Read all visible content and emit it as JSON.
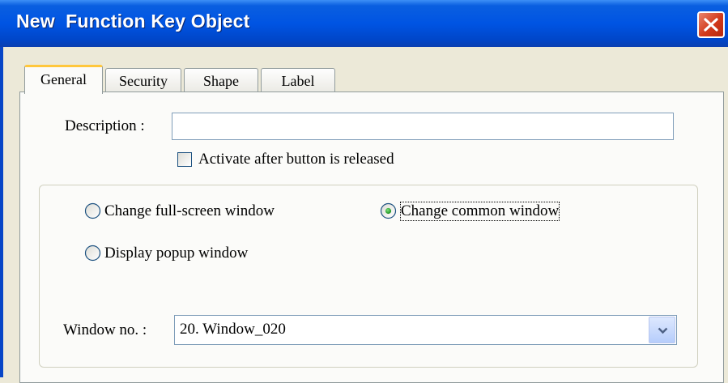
{
  "window": {
    "title": "New  Function Key Object"
  },
  "tabs": [
    {
      "label": "General",
      "active": true
    },
    {
      "label": "Security",
      "active": false
    },
    {
      "label": "Shape",
      "active": false
    },
    {
      "label": "Label",
      "active": false
    }
  ],
  "general": {
    "description_label": "Description :",
    "description_value": "",
    "activate_label": "Activate after button is released",
    "activate_checked": false,
    "mode_options": [
      {
        "label": "Change full-screen window",
        "selected": false
      },
      {
        "label": "Change common window",
        "selected": true
      },
      {
        "label": "Display popup window",
        "selected": false
      }
    ],
    "window_no_label": "Window no. :",
    "window_no_value": "20. Window_020"
  },
  "icons": {
    "close": "close-icon",
    "dropdown": "chevron-down-icon"
  },
  "colors": {
    "titlebar": "#0054e3",
    "active_tab_accent": "#ffc73c",
    "radio_selected": "#21a121"
  }
}
